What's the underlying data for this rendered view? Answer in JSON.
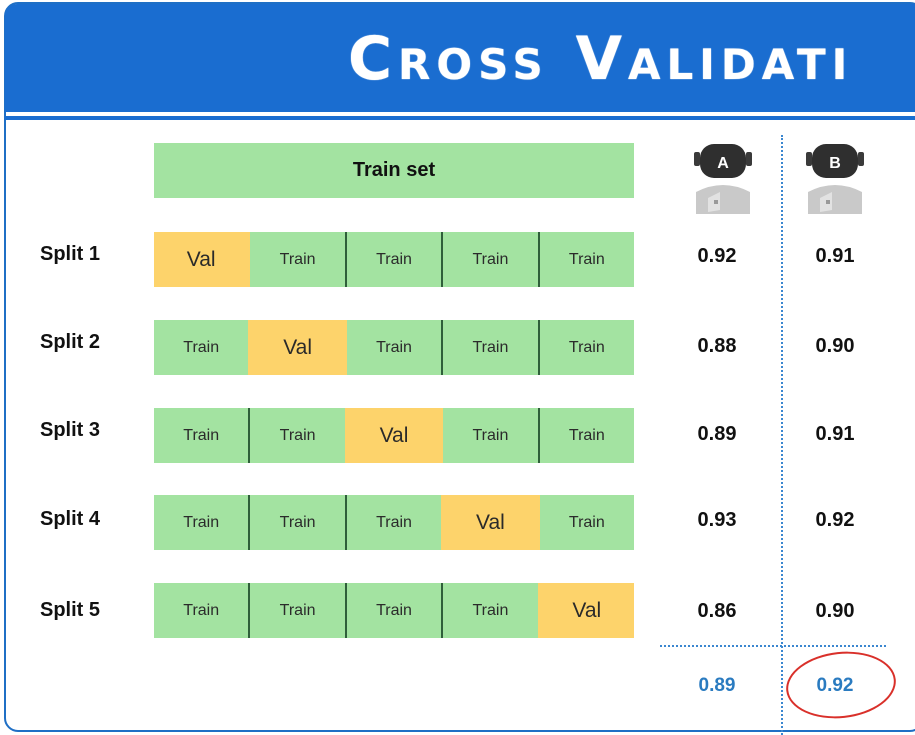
{
  "title": "Cross Validati",
  "train_set_label": "Train set",
  "models": [
    {
      "label": "A",
      "average": "0.89"
    },
    {
      "label": "B",
      "average": "0.92"
    }
  ],
  "splits": [
    {
      "label": "Split 1",
      "cells": [
        "Val",
        "Train",
        "Train",
        "Train",
        "Train"
      ],
      "val_index": 0,
      "score_a": "0.92",
      "score_b": "0.91"
    },
    {
      "label": "Split 2",
      "cells": [
        "Train",
        "Val",
        "Train",
        "Train",
        "Train"
      ],
      "val_index": 1,
      "score_a": "0.88",
      "score_b": "0.90"
    },
    {
      "label": "Split 3",
      "cells": [
        "Train",
        "Train",
        "Val",
        "Train",
        "Train"
      ],
      "val_index": 2,
      "score_a": "0.89",
      "score_b": "0.91"
    },
    {
      "label": "Split 4",
      "cells": [
        "Train",
        "Train",
        "Train",
        "Val",
        "Train"
      ],
      "val_index": 3,
      "score_a": "0.93",
      "score_b": "0.92"
    },
    {
      "label": "Split 5",
      "cells": [
        "Train",
        "Train",
        "Train",
        "Train",
        "Val"
      ],
      "val_index": 4,
      "score_a": "0.86",
      "score_b": "0.90"
    }
  ],
  "colors": {
    "header_blue": "#1a6dd0",
    "train_green": "#a3e3a1",
    "val_yellow": "#fdd36b",
    "average_blue": "#2a7bc0",
    "highlight_red": "#d9302a"
  },
  "icons": [
    "robot-a-icon",
    "robot-b-icon"
  ]
}
